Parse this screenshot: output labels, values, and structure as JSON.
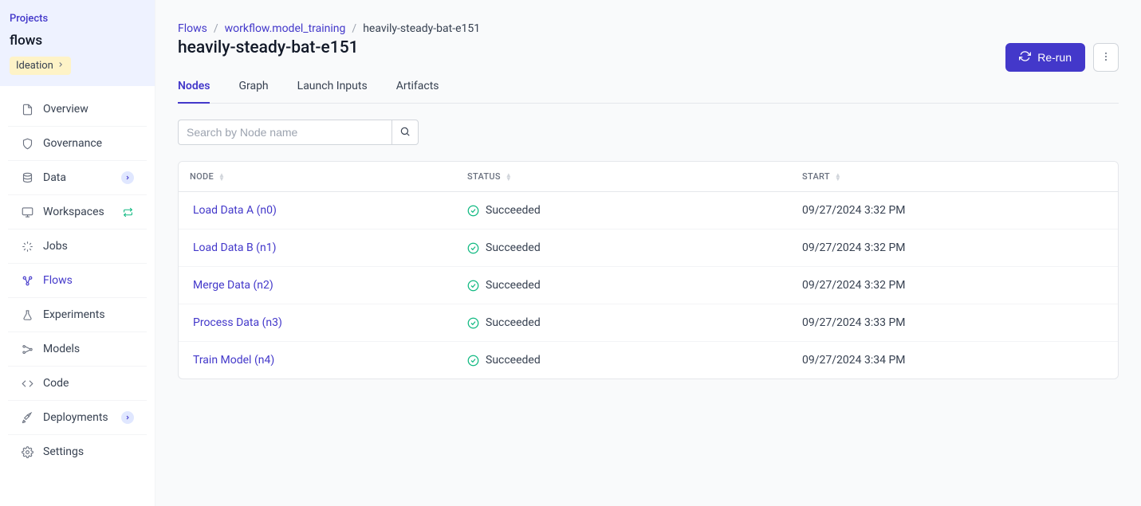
{
  "sidebar": {
    "projects_link": "Projects",
    "project_name": "flows",
    "badge_label": "Ideation",
    "items": [
      {
        "label": "Overview",
        "icon": "file-icon"
      },
      {
        "label": "Governance",
        "icon": "shield-icon"
      },
      {
        "label": "Data",
        "icon": "database-icon",
        "trailing": "chevron-badge"
      },
      {
        "label": "Workspaces",
        "icon": "monitor-icon",
        "trailing": "refresh"
      },
      {
        "label": "Jobs",
        "icon": "loader-icon"
      },
      {
        "label": "Flows",
        "icon": "flow-icon",
        "active": true
      },
      {
        "label": "Experiments",
        "icon": "flask-icon"
      },
      {
        "label": "Models",
        "icon": "model-icon"
      },
      {
        "label": "Code",
        "icon": "code-icon"
      },
      {
        "label": "Deployments",
        "icon": "rocket-icon",
        "trailing": "chevron-badge"
      },
      {
        "label": "Settings",
        "icon": "gear-icon"
      }
    ]
  },
  "breadcrumb": {
    "items": [
      "Flows",
      "workflow.model_training",
      "heavily-steady-bat-e151"
    ]
  },
  "page_title": "heavily-steady-bat-e151",
  "actions": {
    "rerun_label": "Re-run"
  },
  "tabs": [
    {
      "label": "Nodes",
      "active": true
    },
    {
      "label": "Graph"
    },
    {
      "label": "Launch Inputs"
    },
    {
      "label": "Artifacts"
    }
  ],
  "search": {
    "placeholder": "Search by Node name",
    "value": ""
  },
  "table": {
    "headers": [
      "NODE",
      "STATUS",
      "START"
    ],
    "rows": [
      {
        "node": "Load Data A (n0)",
        "status": "Succeeded",
        "start": "09/27/2024 3:32 PM"
      },
      {
        "node": "Load Data B (n1)",
        "status": "Succeeded",
        "start": "09/27/2024 3:32 PM"
      },
      {
        "node": "Merge Data (n2)",
        "status": "Succeeded",
        "start": "09/27/2024 3:32 PM"
      },
      {
        "node": "Process Data (n3)",
        "status": "Succeeded",
        "start": "09/27/2024 3:33 PM"
      },
      {
        "node": "Train Model (n4)",
        "status": "Succeeded",
        "start": "09/27/2024 3:34 PM"
      }
    ]
  },
  "colors": {
    "accent": "#4338ca",
    "success": "#10b981"
  }
}
